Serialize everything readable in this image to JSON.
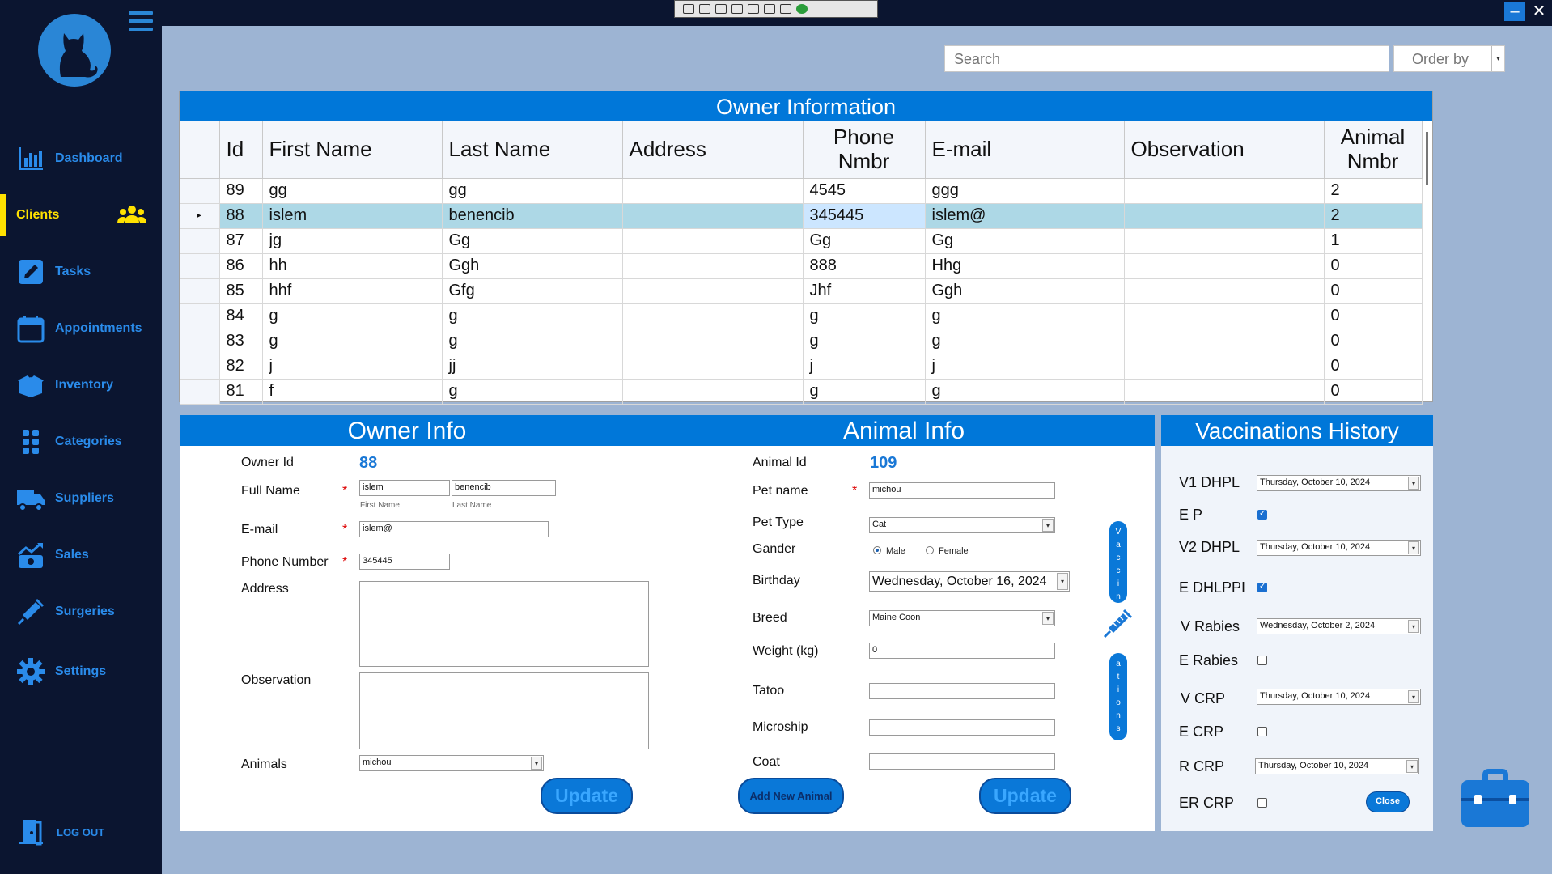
{
  "sidebar": {
    "items": [
      {
        "label": "Dashboard",
        "icon": "chart-icon"
      },
      {
        "label": "Clients",
        "icon": "users-icon"
      },
      {
        "label": "Tasks",
        "icon": "pencil-icon"
      },
      {
        "label": "Appointments",
        "icon": "calendar-icon"
      },
      {
        "label": "Inventory",
        "icon": "box-icon"
      },
      {
        "label": "Categories",
        "icon": "grid-icon"
      },
      {
        "label": "Suppliers",
        "icon": "truck-icon"
      },
      {
        "label": "Sales",
        "icon": "sales-icon"
      },
      {
        "label": "Surgeries",
        "icon": "syringe-icon"
      },
      {
        "label": "Settings",
        "icon": "gear-icon"
      }
    ],
    "logout": "LOG OUT"
  },
  "search": {
    "placeholder": "Search"
  },
  "orderby": {
    "label": "Order by"
  },
  "owner_table": {
    "title": "Owner Information",
    "columns": [
      "Id",
      "First Name",
      "Last Name",
      "Address",
      "Phone Nmbr",
      "E-mail",
      "Observation",
      "Animal Nmbr"
    ],
    "rows": [
      [
        "89",
        "gg",
        "gg",
        "",
        "4545",
        "ggg",
        "",
        "2"
      ],
      [
        "88",
        "islem",
        "benencib",
        "",
        "345445",
        "islem@",
        "",
        "2"
      ],
      [
        "87",
        "jg",
        "Gg",
        "",
        "Gg",
        "Gg",
        "",
        "1"
      ],
      [
        "86",
        "hh",
        "Ggh",
        "",
        "888",
        "Hhg",
        "",
        "0"
      ],
      [
        "85",
        "hhf",
        "Gfg",
        "",
        "Jhf",
        "Ggh",
        "",
        "0"
      ],
      [
        "84",
        "g",
        "g",
        "",
        "g",
        "g",
        "",
        "0"
      ],
      [
        "83",
        "g",
        "g",
        "",
        "g",
        "g",
        "",
        "0"
      ],
      [
        "82",
        "j",
        "jj",
        "",
        "j",
        "j",
        "",
        "0"
      ],
      [
        "81",
        "f",
        "g",
        "",
        "g",
        "g",
        "",
        "0"
      ]
    ]
  },
  "owner_info": {
    "title": "Owner Info",
    "owner_id_label": "Owner Id",
    "owner_id": "88",
    "full_name_label": "Full Name",
    "first_name": "islem",
    "last_name": "benencib",
    "first_name_sub": "First Name",
    "last_name_sub": "Last Name",
    "email_label": "E-mail",
    "email": "islem@",
    "phone_label": "Phone Number",
    "phone": "345445",
    "address_label": "Address",
    "observation_label": "Observation",
    "animals_label": "Animals",
    "animals_value": "michou",
    "update": "Update",
    "required": "*"
  },
  "animal_info": {
    "title": "Animal Info",
    "animal_id_label": "Animal Id",
    "animal_id": "109",
    "pet_name_label": "Pet name",
    "pet_name": "michou",
    "pet_type_label": "Pet Type",
    "pet_type": "Cat",
    "gander_label": "Gander",
    "male": "Male",
    "female": "Female",
    "birthday_label": "Birthday",
    "birthday": "Wednesday, October 16, 2024",
    "breed_label": "Breed",
    "breed": "Maine Coon",
    "weight_label": "Weight (kg)",
    "weight": "0",
    "tatoo_label": "Tatoo",
    "microship_label": "Microship",
    "coat_label": "Coat",
    "add_new_animal": "Add New Animal",
    "update": "Update",
    "vaccinations_top": "Vaccin",
    "vaccinations_bottom": "ations"
  },
  "vaccinations": {
    "title": "Vaccinations History",
    "v1_dhpl": "V1 DHPL",
    "v1_dhpl_date": "Thursday, October 10, 2024",
    "ep": "E P",
    "v2_dhpl": "V2 DHPL",
    "v2_dhpl_date": "Thursday, October 10, 2024",
    "e_dhlppi": "E DHLPPI",
    "v_rabies": "V Rabies",
    "v_rabies_date": "Wednesday, October 2, 2024",
    "e_rabies": "E Rabies",
    "v_crp": "V CRP",
    "v_crp_date": "Thursday, October 10, 2024",
    "e_crp": "E CRP",
    "r_crp": "R CRP",
    "r_crp_date": "Thursday, October 10, 2024",
    "er_crp": "ER CRP",
    "close": "Close"
  },
  "colors": {
    "accent": "#0077d9",
    "sidebar": "#0b1530",
    "active": "#ffe100",
    "background": "#9db4d3"
  }
}
